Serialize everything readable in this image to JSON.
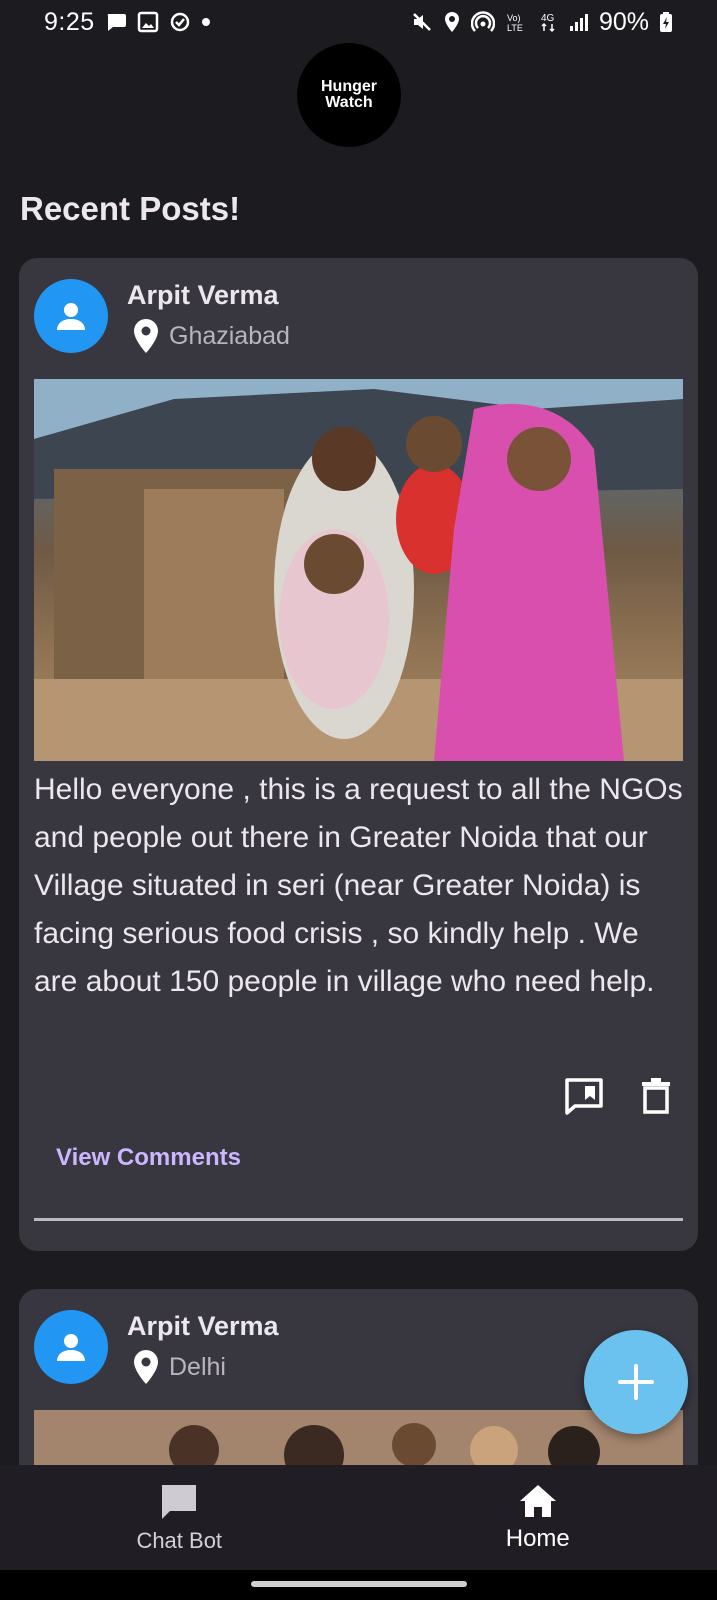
{
  "status_bar": {
    "time": "9:25",
    "battery": "90%",
    "left_icons": [
      "chat-bubble-icon",
      "image-icon",
      "sync-icon",
      "dot-icon"
    ],
    "right_icons": [
      "mute-icon",
      "location-icon",
      "hotspot-icon",
      "volte-icon",
      "4g-icon",
      "signal-icon",
      "battery-icon"
    ]
  },
  "app": {
    "logo_line1": "Hunger",
    "logo_line2": "Watch",
    "section_title": "Recent Posts!"
  },
  "posts": [
    {
      "author": "Arpit Verma",
      "location": "Ghaziabad",
      "body": "Hello everyone , this is a request to all the NGOs and people out there in Greater Noida that our Village situated in seri (near Greater Noida) is facing serious food crisis , so kindly help . We are about 150 people in village who need help.",
      "view_comments_label": "View Comments"
    },
    {
      "author": "Arpit Verma",
      "location": "Delhi"
    }
  ],
  "bottom_nav": {
    "items": [
      {
        "label": "Chat Bot",
        "icon": "chat-icon"
      },
      {
        "label": "Home",
        "icon": "home-icon"
      }
    ]
  },
  "colors": {
    "background": "#1c1b20",
    "card": "#38363e",
    "accent_link": "#cbb6ff",
    "avatar": "#2196f3",
    "fab": "#6cc2ee"
  }
}
